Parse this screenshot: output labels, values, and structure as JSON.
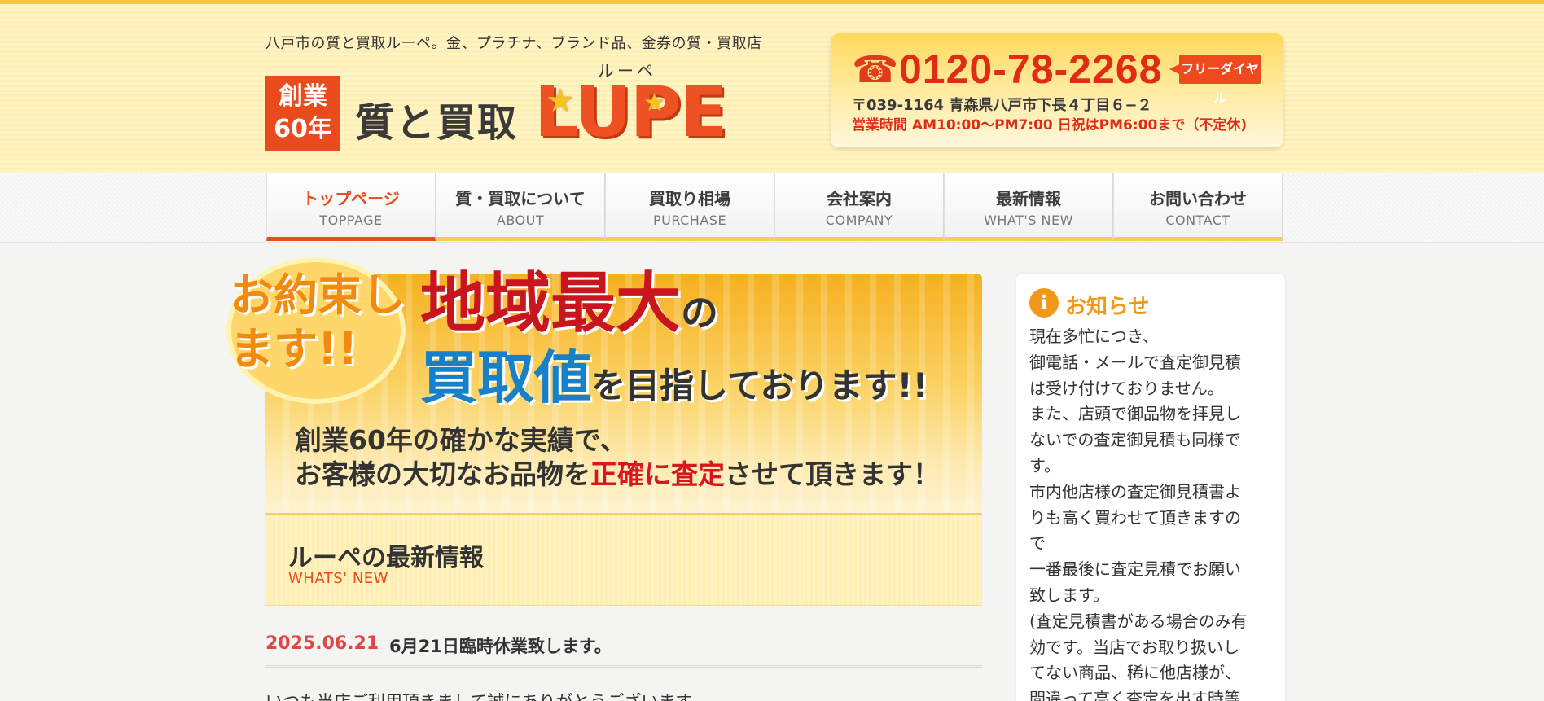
{
  "header": {
    "tagline": "八戸市の質と買取ルーペ。金、プラチナ、ブランド品、金券の質・買取店",
    "badge_line1": "創業",
    "badge_line2": "60年",
    "logo_sub": "質と買取",
    "logo_ruby": "ルーペ",
    "logo_main": "LUPE",
    "phone": "0120-78-2268",
    "freedial": "フリーダイヤル",
    "address": "〒039-1164 青森県八戸市下長４丁目６−２",
    "hours": "営業時間 AM10:00～PM7:00 日祝はPM6:00まで（不定休)"
  },
  "nav": {
    "items": [
      {
        "jp": "トップページ",
        "en": "TOPPAGE"
      },
      {
        "jp": "質・買取について",
        "en": "ABOUT"
      },
      {
        "jp": "買取り相場",
        "en": "PURCHASE"
      },
      {
        "jp": "会社案内",
        "en": "COMPANY"
      },
      {
        "jp": "最新情報",
        "en": "WHAT'S NEW"
      },
      {
        "jp": "お問い合わせ",
        "en": "CONTACT"
      }
    ]
  },
  "banner": {
    "promise": "お約束します!!",
    "headline1_main": "地域最大",
    "headline1_no": "の",
    "headline2_main": "買取値",
    "headline2_rest": "を目指しております!!",
    "sub1": "創業60年の確かな実績で、",
    "sub2_pre": "お客様の大切なお品物を",
    "sub2_red": "正確に査定",
    "sub2_post": "させて頂きます！"
  },
  "news": {
    "title": "ルーペの最新情報",
    "subtitle": "WHATS' NEW",
    "date": "2025.06.21",
    "headline": "6月21日臨時休業致します。",
    "body": "いつも当店ご利用頂きまして誠にありがとうございます。"
  },
  "sidebar": {
    "title": "お知らせ",
    "lines": [
      "現在多忙につき、",
      "御電話・メールで査定御見積",
      "は受け付けておりません。",
      "また、店頭で御品物を拝見し",
      "ないでの査定御見積も同様で",
      "す。",
      "市内他店様の査定御見積書よ",
      "りも高く買わせて頂きますの",
      "で",
      "一番最後に査定見積でお願い",
      "致します。",
      "(査定見積書がある場合のみ有",
      "効です。当店でお取り扱いし",
      "てない商品、稀に他店様が、",
      "間違って高く査定を出す時等"
    ]
  },
  "colors": {
    "accent_orange": "#e94a1e",
    "accent_red": "#d8161e",
    "accent_blue": "#1680c8",
    "header_yellow": "#fff4c4"
  }
}
